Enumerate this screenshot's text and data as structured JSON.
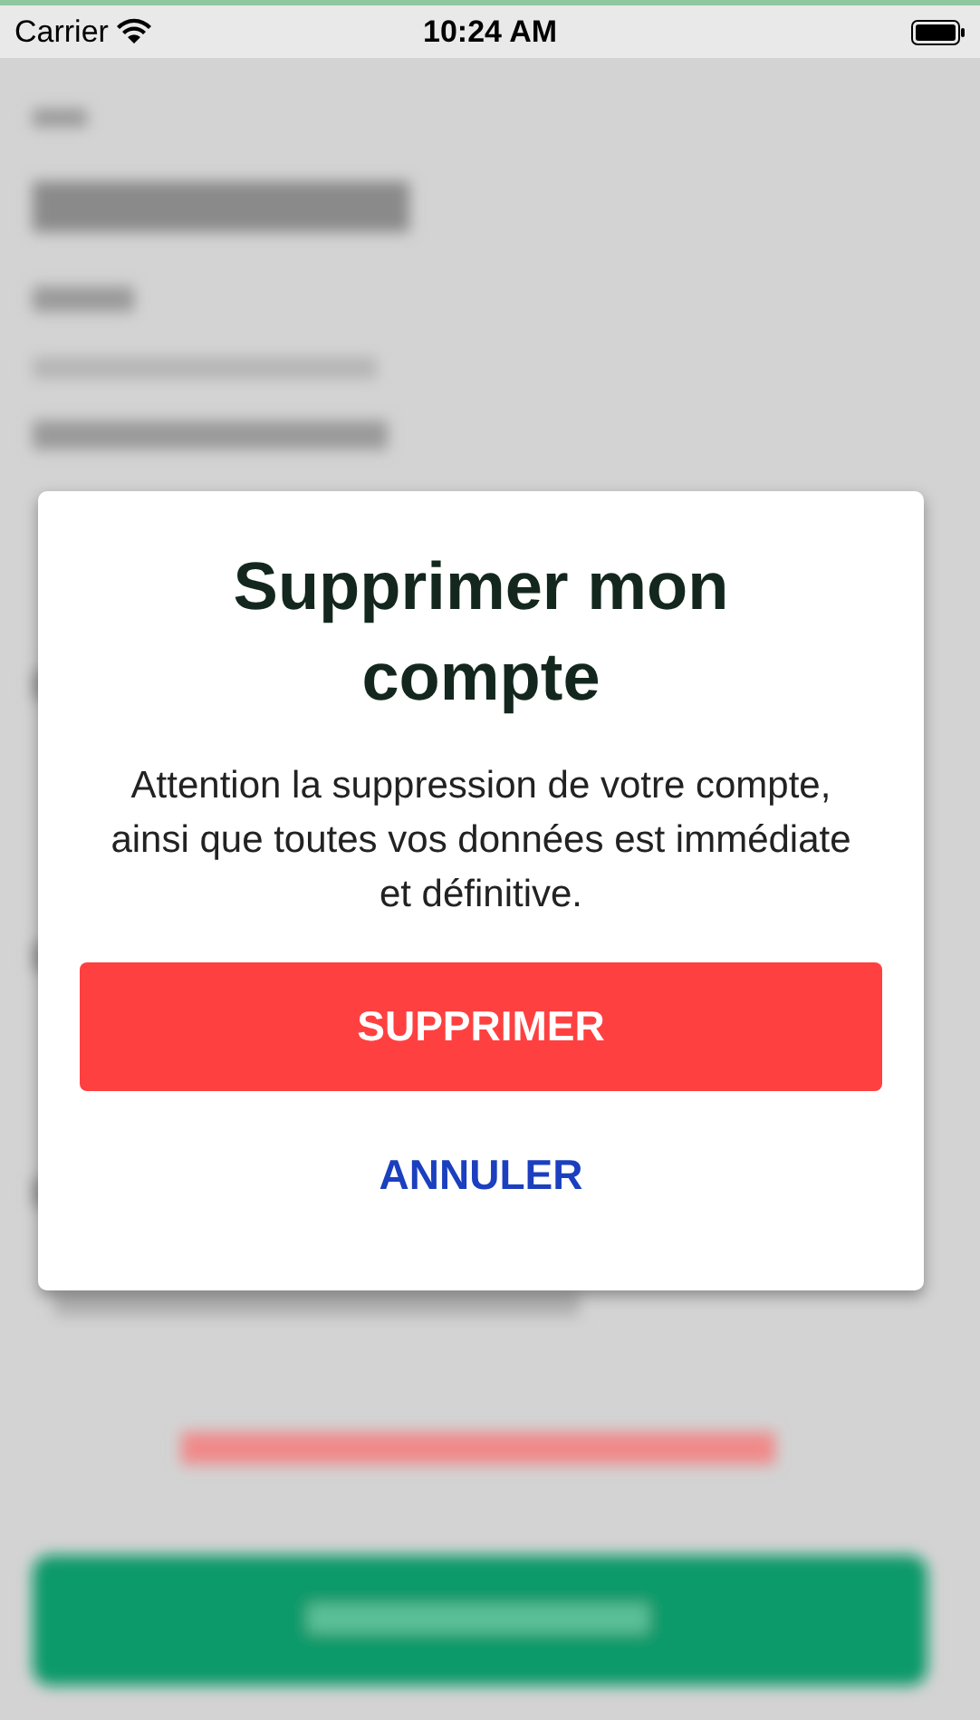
{
  "status_bar": {
    "carrier": "Carrier",
    "time": "10:24 AM"
  },
  "dialog": {
    "title": "Supprimer mon compte",
    "message": "Attention la suppression de votre compte, ainsi que toutes vos données est immédiate et définitive.",
    "buttons": [
      {
        "label": "SUPPRIMER",
        "kind": "primary"
      },
      {
        "label": "ANNULER",
        "kind": "text"
      }
    ]
  }
}
